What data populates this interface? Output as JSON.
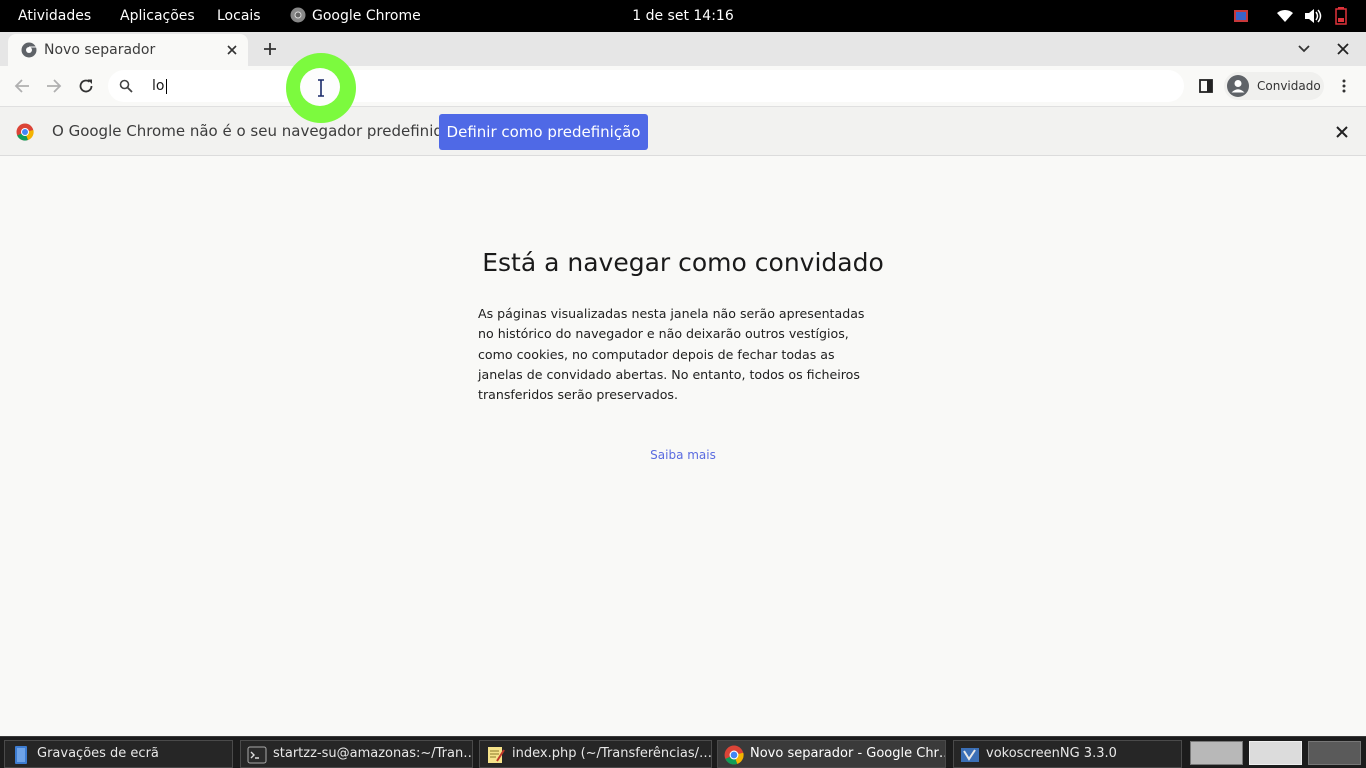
{
  "topbar": {
    "activities": "Atividades",
    "applications": "Aplicações",
    "places": "Locais",
    "app_name": "Google Chrome",
    "clock": "1 de set  14:16",
    "tray_icons": [
      "screen-record-icon",
      "wifi-icon",
      "volume-icon",
      "battery-icon"
    ]
  },
  "browser": {
    "tab_title": "Novo separador",
    "address_value": "lo",
    "profile_label": "Convidado"
  },
  "infobar": {
    "message": "O Google Chrome não é o seu navegador predefinido.",
    "button_label": "Definir como predefinição"
  },
  "page": {
    "heading": "Está a navegar como convidado",
    "body": "As páginas visualizadas nesta janela não serão apresentadas no histórico do navegador e não deixarão outros vestígios, como cookies, no computador depois de fechar todas as janelas de convidado abertas. No entanto, todos os ficheiros transferidos serão preservados.",
    "learn_more": "Saiba mais"
  },
  "taskbar": {
    "items": [
      {
        "label": "Gravações de ecrã",
        "icon": "file-manager-icon",
        "active": false
      },
      {
        "label": "startzz-su@amazonas:~/Tran…",
        "icon": "terminal-icon",
        "active": false
      },
      {
        "label": "index.php (~/Transferências/…",
        "icon": "text-editor-icon",
        "active": false
      },
      {
        "label": "Novo separador - Google Chr…",
        "icon": "chrome-icon",
        "active": true
      },
      {
        "label": "vokoscreenNG 3.3.0",
        "icon": "vokoscreen-icon",
        "active": false
      }
    ]
  },
  "colors": {
    "accent_button": "#4f69e6",
    "link": "#5a6be0",
    "cursor_highlight": "#7cfa3e"
  }
}
